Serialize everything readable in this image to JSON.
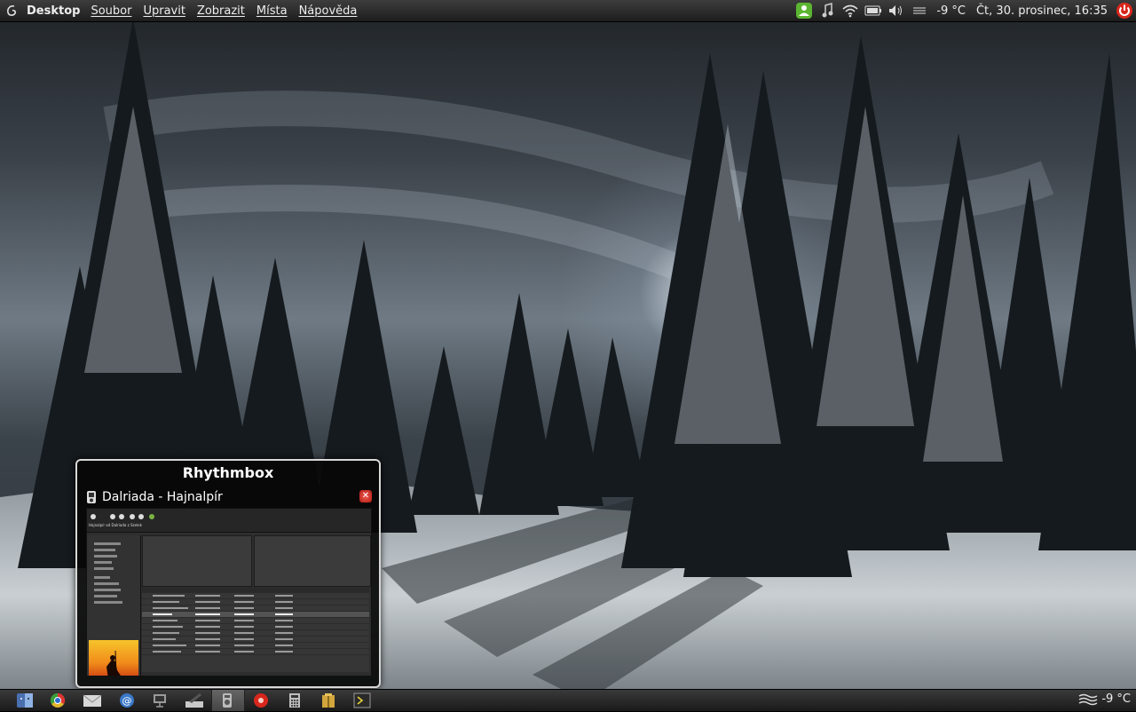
{
  "top_panel": {
    "logo_icon": "debian-swirl-icon",
    "app_title": "Desktop",
    "menu": [
      "Soubor",
      "Upravit",
      "Zobrazit",
      "Místa",
      "Nápověda"
    ],
    "tray_icons": [
      "user-status-icon",
      "music-note-icon",
      "wifi-icon",
      "battery-icon",
      "volume-icon",
      "weather-icon"
    ],
    "temperature": "-9 °C",
    "datetime": "Čt, 30. prosinec, 16:35",
    "power_icon": "power-icon"
  },
  "popup": {
    "app_name": "Rhythmbox",
    "window_title": "Dalriada - Hajnalpír",
    "window_icon": "media-player-icon",
    "close_icon": "close-icon",
    "thumbnail_song": "Hajnalpír od Dalriada z Szelek"
  },
  "bottom_panel": {
    "launchers": [
      {
        "name": "finder-icon",
        "color": "#4a6fb0"
      },
      {
        "name": "chrome-icon",
        "color": "#e2b52d"
      },
      {
        "name": "mail-icon",
        "color": "#d8d8d8"
      },
      {
        "name": "email-client-icon",
        "color": "#3a78c8"
      },
      {
        "name": "network-monitor-icon",
        "color": "#9a9a9a"
      },
      {
        "name": "text-editor-icon",
        "color": "#c9c9c9"
      },
      {
        "name": "rhythmbox-icon",
        "color": "#777777"
      },
      {
        "name": "recorder-icon",
        "color": "#d8271c"
      },
      {
        "name": "calculator-icon",
        "color": "#bdbdbd"
      },
      {
        "name": "archive-icon",
        "color": "#d1a63c"
      },
      {
        "name": "terminal-icon",
        "color": "#2a2a2a"
      }
    ],
    "weather_icon": "fog-icon",
    "temperature": "-9 °C"
  },
  "colors": {
    "panel": "#2b2b2b",
    "popup_border": "#d8d8d8",
    "close": "#d83b30",
    "accent_green": "#5cb531"
  }
}
